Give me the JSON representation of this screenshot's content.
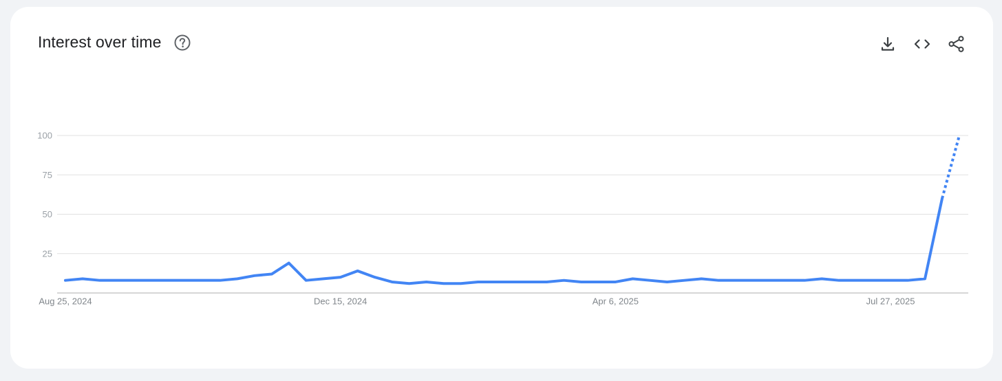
{
  "header": {
    "title": "Interest over time",
    "help_icon": "help-circle-icon"
  },
  "toolbar": {
    "download_icon": "download-icon",
    "embed_icon": "embed-code-icon",
    "share_icon": "share-icon"
  },
  "colors": {
    "line": "#4285f4",
    "grid": "#e0e0e0",
    "axis": "#bdbdbd"
  },
  "chart_data": {
    "type": "line",
    "ylim": [
      0,
      100
    ],
    "yticks": [
      25,
      50,
      75,
      100
    ],
    "x_tick_labels": [
      "Aug 25, 2024",
      "Dec 15, 2024",
      "Apr 6, 2025",
      "Jul 27, 2025"
    ],
    "x_tick_indices": [
      0,
      16,
      32,
      48
    ],
    "series": [
      {
        "values": [
          8,
          9,
          8,
          8,
          8,
          8,
          8,
          8,
          8,
          8,
          9,
          11,
          12,
          19,
          8,
          9,
          10,
          14,
          10,
          7,
          6,
          7,
          6,
          6,
          7,
          7,
          7,
          7,
          7,
          8,
          7,
          7,
          7,
          9,
          8,
          7,
          8,
          9,
          8,
          8,
          8,
          8,
          8,
          8,
          9,
          8,
          8,
          8,
          8,
          8,
          9,
          60,
          100
        ],
        "partial_from_index": 51
      }
    ]
  }
}
